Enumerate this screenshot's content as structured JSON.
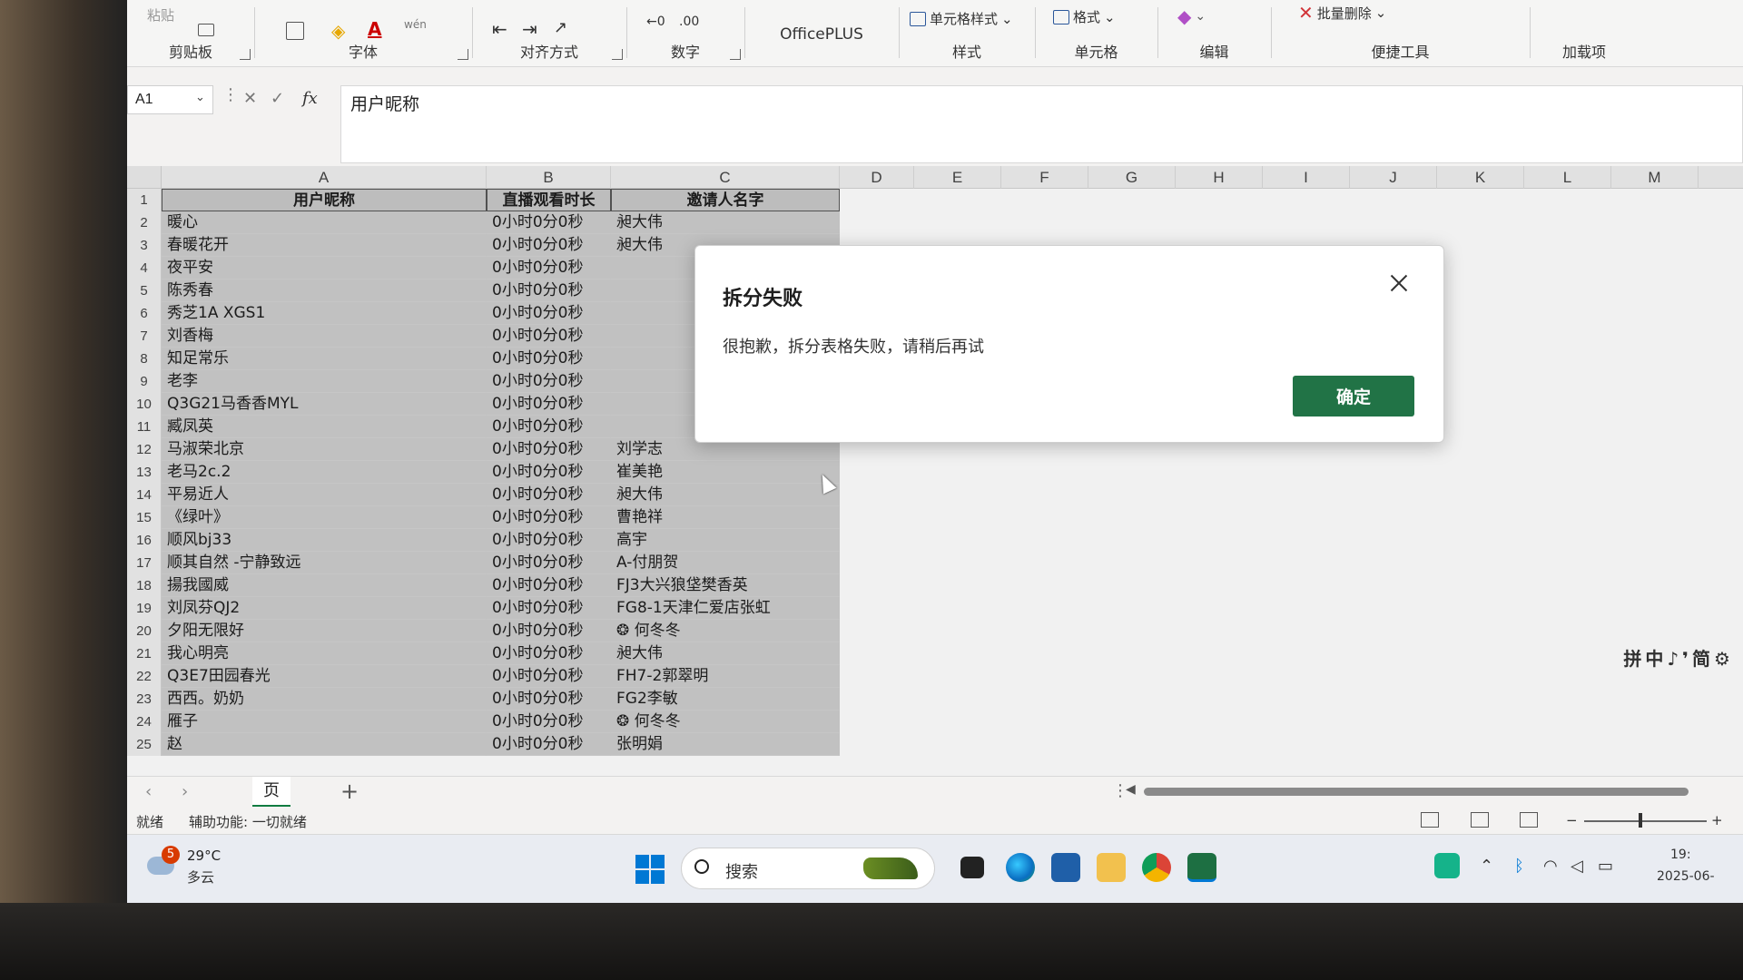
{
  "ribbon": {
    "clipboard": {
      "label": "剪贴板",
      "paste": "粘贴"
    },
    "font": {
      "label": "字体"
    },
    "alignment": {
      "label": "对齐方式"
    },
    "number": {
      "label": "数字"
    },
    "officeplus": {
      "label": "OfficePLUS"
    },
    "styles": {
      "label": "样式",
      "cell_styles": "单元格样式"
    },
    "cells": {
      "label": "单元格",
      "format": "格式"
    },
    "editing": {
      "label": "编辑"
    },
    "tools": {
      "label": "便捷工具",
      "batch_delete": "批量删除"
    },
    "addins": {
      "label": "加载项"
    }
  },
  "formula_bar": {
    "name_box": "A1",
    "content": "用户昵称"
  },
  "columns": [
    "A",
    "B",
    "C",
    "D",
    "E",
    "F",
    "G",
    "H",
    "I",
    "J",
    "K",
    "L",
    "M"
  ],
  "table": {
    "headers": [
      "用户昵称",
      "直播观看时长",
      "邀请人名字"
    ],
    "rows": [
      [
        "暖心",
        "0小时0分0秒",
        "昶大伟"
      ],
      [
        "春暖花开",
        "0小时0分0秒",
        "昶大伟"
      ],
      [
        "夜平安",
        "0小时0分0秒",
        ""
      ],
      [
        "陈秀春",
        "0小时0分0秒",
        ""
      ],
      [
        "秀芝1A XGS1",
        "0小时0分0秒",
        ""
      ],
      [
        "刘香梅",
        "0小时0分0秒",
        ""
      ],
      [
        "知足常乐",
        "0小时0分0秒",
        ""
      ],
      [
        "老李",
        "0小时0分0秒",
        ""
      ],
      [
        "Q3G21马香香MYL",
        "0小时0分0秒",
        ""
      ],
      [
        "臧凤英",
        "0小时0分0秒",
        ""
      ],
      [
        "马淑荣北京",
        "0小时0分0秒",
        "刘学志"
      ],
      [
        "老马2c.2",
        "0小时0分0秒",
        "崔美艳"
      ],
      [
        "平易近人",
        "0小时0分0秒",
        "昶大伟"
      ],
      [
        "《绿叶》",
        "0小时0分0秒",
        "曹艳祥"
      ],
      [
        "顺风bj33",
        "0小时0分0秒",
        "高宇"
      ],
      [
        "顺其自然 -宁静致远",
        "0小时0分0秒",
        "A-付朋贺"
      ],
      [
        "揚我國威",
        "0小时0分0秒",
        "FJ3大兴狼垡樊香英"
      ],
      [
        "刘凤芬QJ2",
        "0小时0分0秒",
        "FG8-1天津仁爱店张虹"
      ],
      [
        "夕阳无限好",
        "0小时0分0秒",
        "❂ 何冬冬"
      ],
      [
        "我心明亮",
        "0小时0分0秒",
        "昶大伟"
      ],
      [
        "Q3E7田园春光",
        "0小时0分0秒",
        "FH7-2郭翠明"
      ],
      [
        "西西。奶奶",
        "0小时0分0秒",
        "FG2李敏"
      ],
      [
        "雁子",
        "0小时0分0秒",
        "❂ 何冬冬"
      ],
      [
        "赵",
        "0小时0分0秒",
        "张明娟"
      ]
    ]
  },
  "ime_bar": "拼中♪❜简⚙",
  "sheet_tab": "页",
  "status": {
    "ready": "就绪",
    "accessibility": "辅助功能: 一切就绪"
  },
  "taskbar": {
    "weather_badge": "5",
    "weather_temp": "29°C",
    "weather_desc": "多云",
    "search": "搜索",
    "time": "19:",
    "date": "2025-06-"
  },
  "dialog": {
    "title": "拆分失败",
    "message": "很抱歉，拆分表格失败，请稍后再试",
    "ok": "确定"
  },
  "colors": {
    "accent": "#217346",
    "windows_blue": "#0078d4"
  }
}
